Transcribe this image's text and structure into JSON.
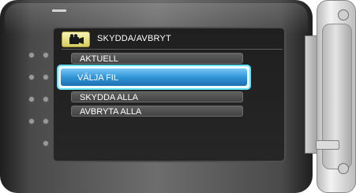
{
  "menu": {
    "header": {
      "title": "SKYDDA/AVBRYT",
      "icon": "video-camera-icon"
    },
    "items": [
      {
        "label": "AKTUELL",
        "selected": false
      },
      {
        "label": "VÄLJA FIL",
        "selected": true
      },
      {
        "label": "SKYDDA ALLA",
        "selected": false
      },
      {
        "label": "AVBRYTA ALLA",
        "selected": false
      }
    ]
  },
  "colors": {
    "highlight": "#2f93d6",
    "highlight_outline": "#63e3ff",
    "header_tab": "#e6df84",
    "screen": "#222222"
  }
}
